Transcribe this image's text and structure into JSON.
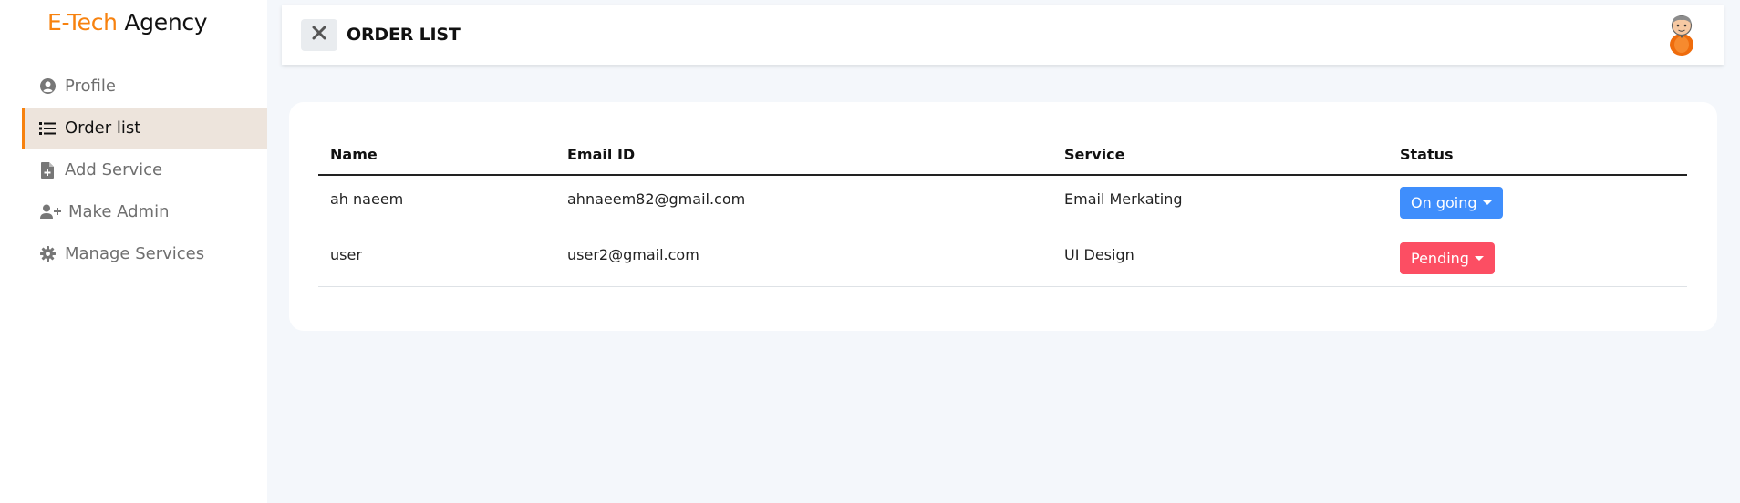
{
  "brand": {
    "accent": "E-Tech",
    "rest": " Agency",
    "accent_color": "#f7820f"
  },
  "sidebar": {
    "items": [
      {
        "label": "Profile",
        "icon": "user-circle-icon",
        "active": false
      },
      {
        "label": "Order list",
        "icon": "list-icon",
        "active": true
      },
      {
        "label": "Add Service",
        "icon": "file-plus-icon",
        "active": false
      },
      {
        "label": "Make Admin",
        "icon": "user-plus-icon",
        "active": false
      },
      {
        "label": "Manage Services",
        "icon": "gear-icon",
        "active": false
      }
    ]
  },
  "header": {
    "title": "ORDER LIST",
    "close_icon": "close-icon",
    "avatar_icon": "avatar-icon"
  },
  "table": {
    "columns": [
      "Name",
      "Email ID",
      "Service",
      "Status"
    ],
    "rows": [
      {
        "name": "ah naeem",
        "email": "ahnaeem82@gmail.com",
        "service": "Email Merkating",
        "status": "On going",
        "status_color": "#3f8efc"
      },
      {
        "name": "user",
        "email": "user2@gmail.com",
        "service": "UI Design",
        "status": "Pending",
        "status_color": "#fc4e63"
      }
    ]
  }
}
